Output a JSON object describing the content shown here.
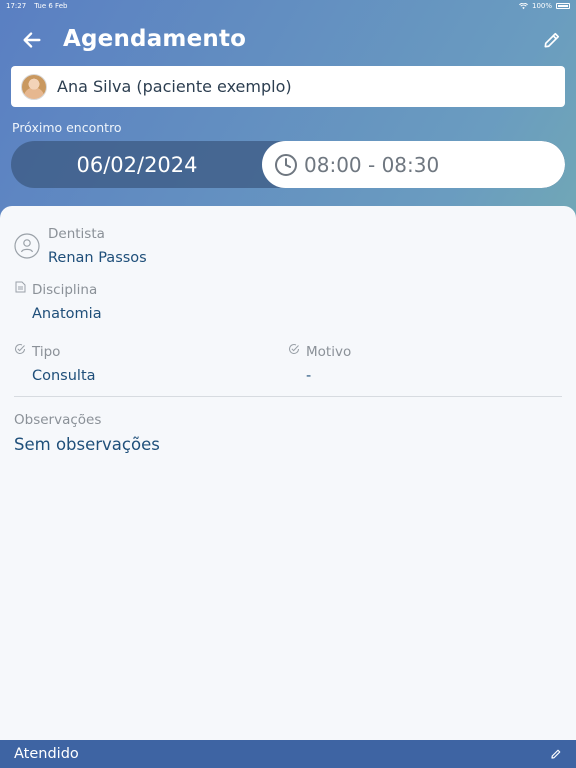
{
  "status_bar": {
    "time": "17:27",
    "date": "Tue 6 Feb",
    "battery": "100%"
  },
  "header": {
    "title": "Agendamento",
    "back_icon": "arrow-left-icon",
    "edit_icon": "pencil-icon"
  },
  "patient": {
    "name": "Ana Silva (paciente exemplo)"
  },
  "schedule": {
    "label": "Próximo encontro",
    "date": "06/02/2024",
    "time": "08:00 - 08:30"
  },
  "details": {
    "dentista_label": "Dentista",
    "dentista_value": "Renan Passos",
    "disciplina_label": "Disciplina",
    "disciplina_value": "Anatomia",
    "tipo_label": "Tipo",
    "tipo_value": "Consulta",
    "motivo_label": "Motivo",
    "motivo_value": "-",
    "observacoes_label": "Observações",
    "observacoes_value": "Sem observações"
  },
  "bottom_bar": {
    "status": "Atendido"
  },
  "colors": {
    "header_gradient_start": "#5a7fc2",
    "header_gradient_end": "#7fc0a0",
    "value_text": "#1f4f7a",
    "bottom_bar": "#3e64a3"
  }
}
